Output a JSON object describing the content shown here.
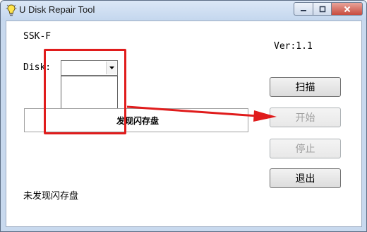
{
  "window": {
    "title": "U Disk Repair Tool",
    "app_icon": "lightbulb-icon",
    "caption_buttons": {
      "minimize": "minimize-icon",
      "maximize": "maximize-icon",
      "close": "close-icon"
    }
  },
  "labels": {
    "device": "SSK-F",
    "version": "Ver:1.1",
    "disk": "Disk:"
  },
  "disk_combo": {
    "value": "",
    "options": []
  },
  "status": {
    "panel_text": "发现闪存盘",
    "bottom_text": "未发现闪存盘"
  },
  "buttons": {
    "scan": "扫描",
    "start": "开始",
    "stop": "停止",
    "exit": "退出"
  },
  "colors": {
    "annotation": "#e01c1c",
    "disabled_text": "#a0a0a0"
  }
}
